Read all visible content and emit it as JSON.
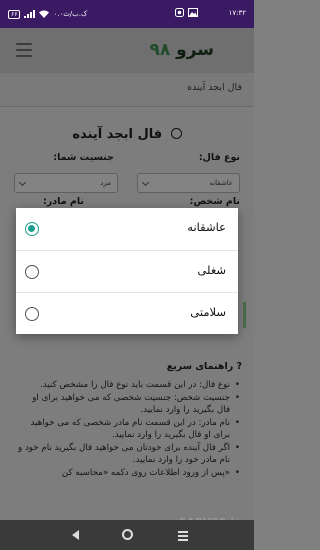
{
  "status_bar": {
    "time": "۱۷:۳۲",
    "speed": "۰.۰ک.ب/ث",
    "battery": "۶۶"
  },
  "app_bar": {
    "brand_text": "سرو",
    "brand_number": "۹۸"
  },
  "breadcrumb": "فال ابجد آینده",
  "page": {
    "title": "فال ابجد آینده",
    "fal_type_label": "نوع فال:",
    "fal_type_value": "عاشقانه",
    "gender_label": "جنسیت شما:",
    "gender_value": "مرد",
    "person_name_label": "نام شخص:",
    "mother_name_label": "نام مادر:"
  },
  "help": {
    "title": "راهنمای سریع",
    "items": [
      "نوع فال: در این قسمت باید نوع فال را مشخص کنید.",
      "جنسیت شخص: جنسیت شخصی که می خواهید برای او فال بگیرید را وارد نمایید.",
      "نام مادر: در این قسمت نام مادر شخصی که می خواهید برای او فال بگیرید را وارد نمایید.",
      "اگر فال آینده برای خودتان می خواهید فال بگیرید نام خود و نام مادر خود را وارد نمایید.",
      "«پس از ورود اطلاعات روی دکمه «محاسبه کن"
    ]
  },
  "watermark": "SARV98.ir",
  "dialog": {
    "options": [
      {
        "label": "عاشقانه",
        "checked": true
      },
      {
        "label": "شغلی",
        "checked": false
      },
      {
        "label": "سلامتی",
        "checked": false
      }
    ]
  },
  "colors": {
    "status_bar": "#3a1a63",
    "accent": "#1e9e8e"
  }
}
